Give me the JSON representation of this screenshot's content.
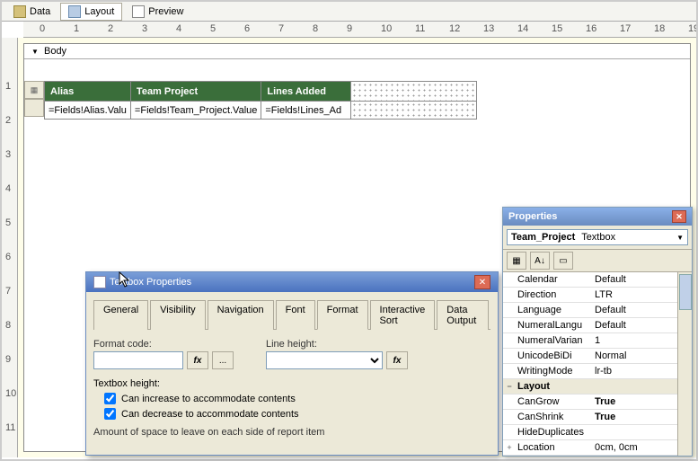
{
  "tabs": {
    "data": "Data",
    "layout": "Layout",
    "preview": "Preview"
  },
  "body_label": "Body",
  "table": {
    "headers": [
      "Alias",
      "Team Project",
      "Lines Added"
    ],
    "cells": [
      "=Fields!Alias.Valu",
      "=Fields!Team_Project.Value",
      "=Fields!Lines_Ad"
    ]
  },
  "dialog": {
    "title": "Textbox Properties",
    "tabs": [
      "General",
      "Visibility",
      "Navigation",
      "Font",
      "Format",
      "Interactive Sort",
      "Data Output"
    ],
    "format_code_label": "Format code:",
    "line_height_label": "Line height:",
    "textbox_height_label": "Textbox height:",
    "can_increase": "Can increase to accommodate contents",
    "can_decrease": "Can decrease to accommodate contents",
    "space_label": "Amount of space to leave on each side of report item",
    "fx": "fx",
    "dots": "..."
  },
  "props": {
    "title": "Properties",
    "selector_name": "Team_Project",
    "selector_type": "Textbox",
    "rows": [
      {
        "name": "Calendar",
        "val": "Default"
      },
      {
        "name": "Direction",
        "val": "LTR"
      },
      {
        "name": "Language",
        "val": "Default"
      },
      {
        "name": "NumeralLangu",
        "val": "Default"
      },
      {
        "name": "NumeralVarian",
        "val": "1"
      },
      {
        "name": "UnicodeBiDi",
        "val": "Normal"
      },
      {
        "name": "WritingMode",
        "val": "lr-tb"
      }
    ],
    "layout_cat": "Layout",
    "layout_rows": [
      {
        "name": "CanGrow",
        "val": "True",
        "bold": true
      },
      {
        "name": "CanShrink",
        "val": "True",
        "bold": true
      },
      {
        "name": "HideDuplicates",
        "val": ""
      },
      {
        "name": "Location",
        "val": "0cm, 0cm",
        "exp": "+"
      }
    ]
  },
  "ruler_h": [
    "0",
    "1",
    "2",
    "3",
    "4",
    "5",
    "6",
    "7",
    "8",
    "9",
    "10",
    "11",
    "12",
    "13",
    "14",
    "15",
    "16",
    "17",
    "18",
    "19"
  ],
  "ruler_v": [
    "",
    "1",
    "2",
    "3",
    "4",
    "5",
    "6",
    "7",
    "8",
    "9",
    "10",
    "11"
  ]
}
